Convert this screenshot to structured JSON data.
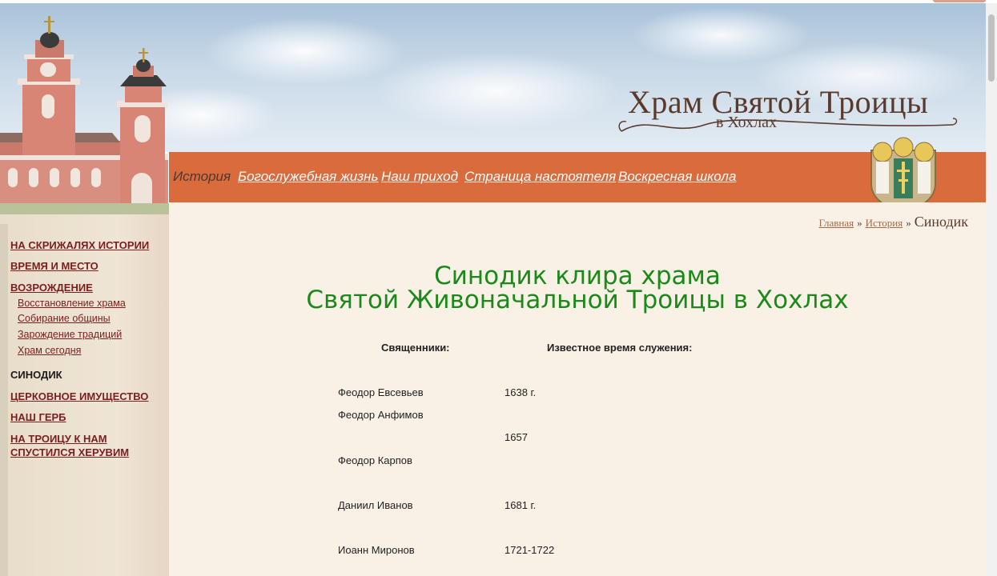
{
  "logo": {
    "main": "Храм Святой Троицы",
    "sub": "в Хохлах"
  },
  "nav": [
    {
      "label": "История",
      "current": true
    },
    {
      "label": "Богослужебная жизнь"
    },
    {
      "label": "Наш приход"
    },
    {
      "label": "Страница настоятеля"
    },
    {
      "label": "Воскресная школа"
    }
  ],
  "sidebar": {
    "items": [
      "НА СКРИЖАЛЯХ ИСТОРИИ",
      "ВРЕМЯ И МЕСТО",
      "ВОЗРОЖДЕНИЕ",
      "СИНОДИК",
      "ЦЕРКОВНОЕ ИМУЩЕСТВО",
      "НАШ ГЕРБ",
      "НА ТРОИЦУ К НАМ",
      "СПУСТИЛСЯ ХЕРУВИМ"
    ],
    "subitems": [
      "Восстановление храма",
      "Собирание общины",
      "Зарождение традиций",
      "Храм сегодня"
    ]
  },
  "breadcrumb": {
    "home": "Главная",
    "section": "История",
    "sep": "»",
    "current": "Синодик"
  },
  "page": {
    "title_line1": "Синодик клира храма",
    "title_line2": "Святой Живоначальной Троицы в Хохлах"
  },
  "table": {
    "headers": [
      "Священники:",
      "Известное время служения:"
    ],
    "rows": [
      {
        "name": "Феодор Евсевьев",
        "time": "1638 г."
      },
      {
        "name": "Феодор Анфимов",
        "time": ""
      },
      {
        "name": "",
        "time": "1657"
      },
      {
        "name": "Феодор Карпов",
        "time": ""
      },
      {
        "name": "Даниил Иванов",
        "time": "1681 г."
      },
      {
        "name": "Иоанн Миронов",
        "time": "1721-1722"
      }
    ]
  },
  "colors": {
    "nav_bar": "#d96b3c",
    "title_green": "#1b8a1b",
    "link_maroon": "#7b1e1e",
    "content_bg": "#faf1e6"
  }
}
